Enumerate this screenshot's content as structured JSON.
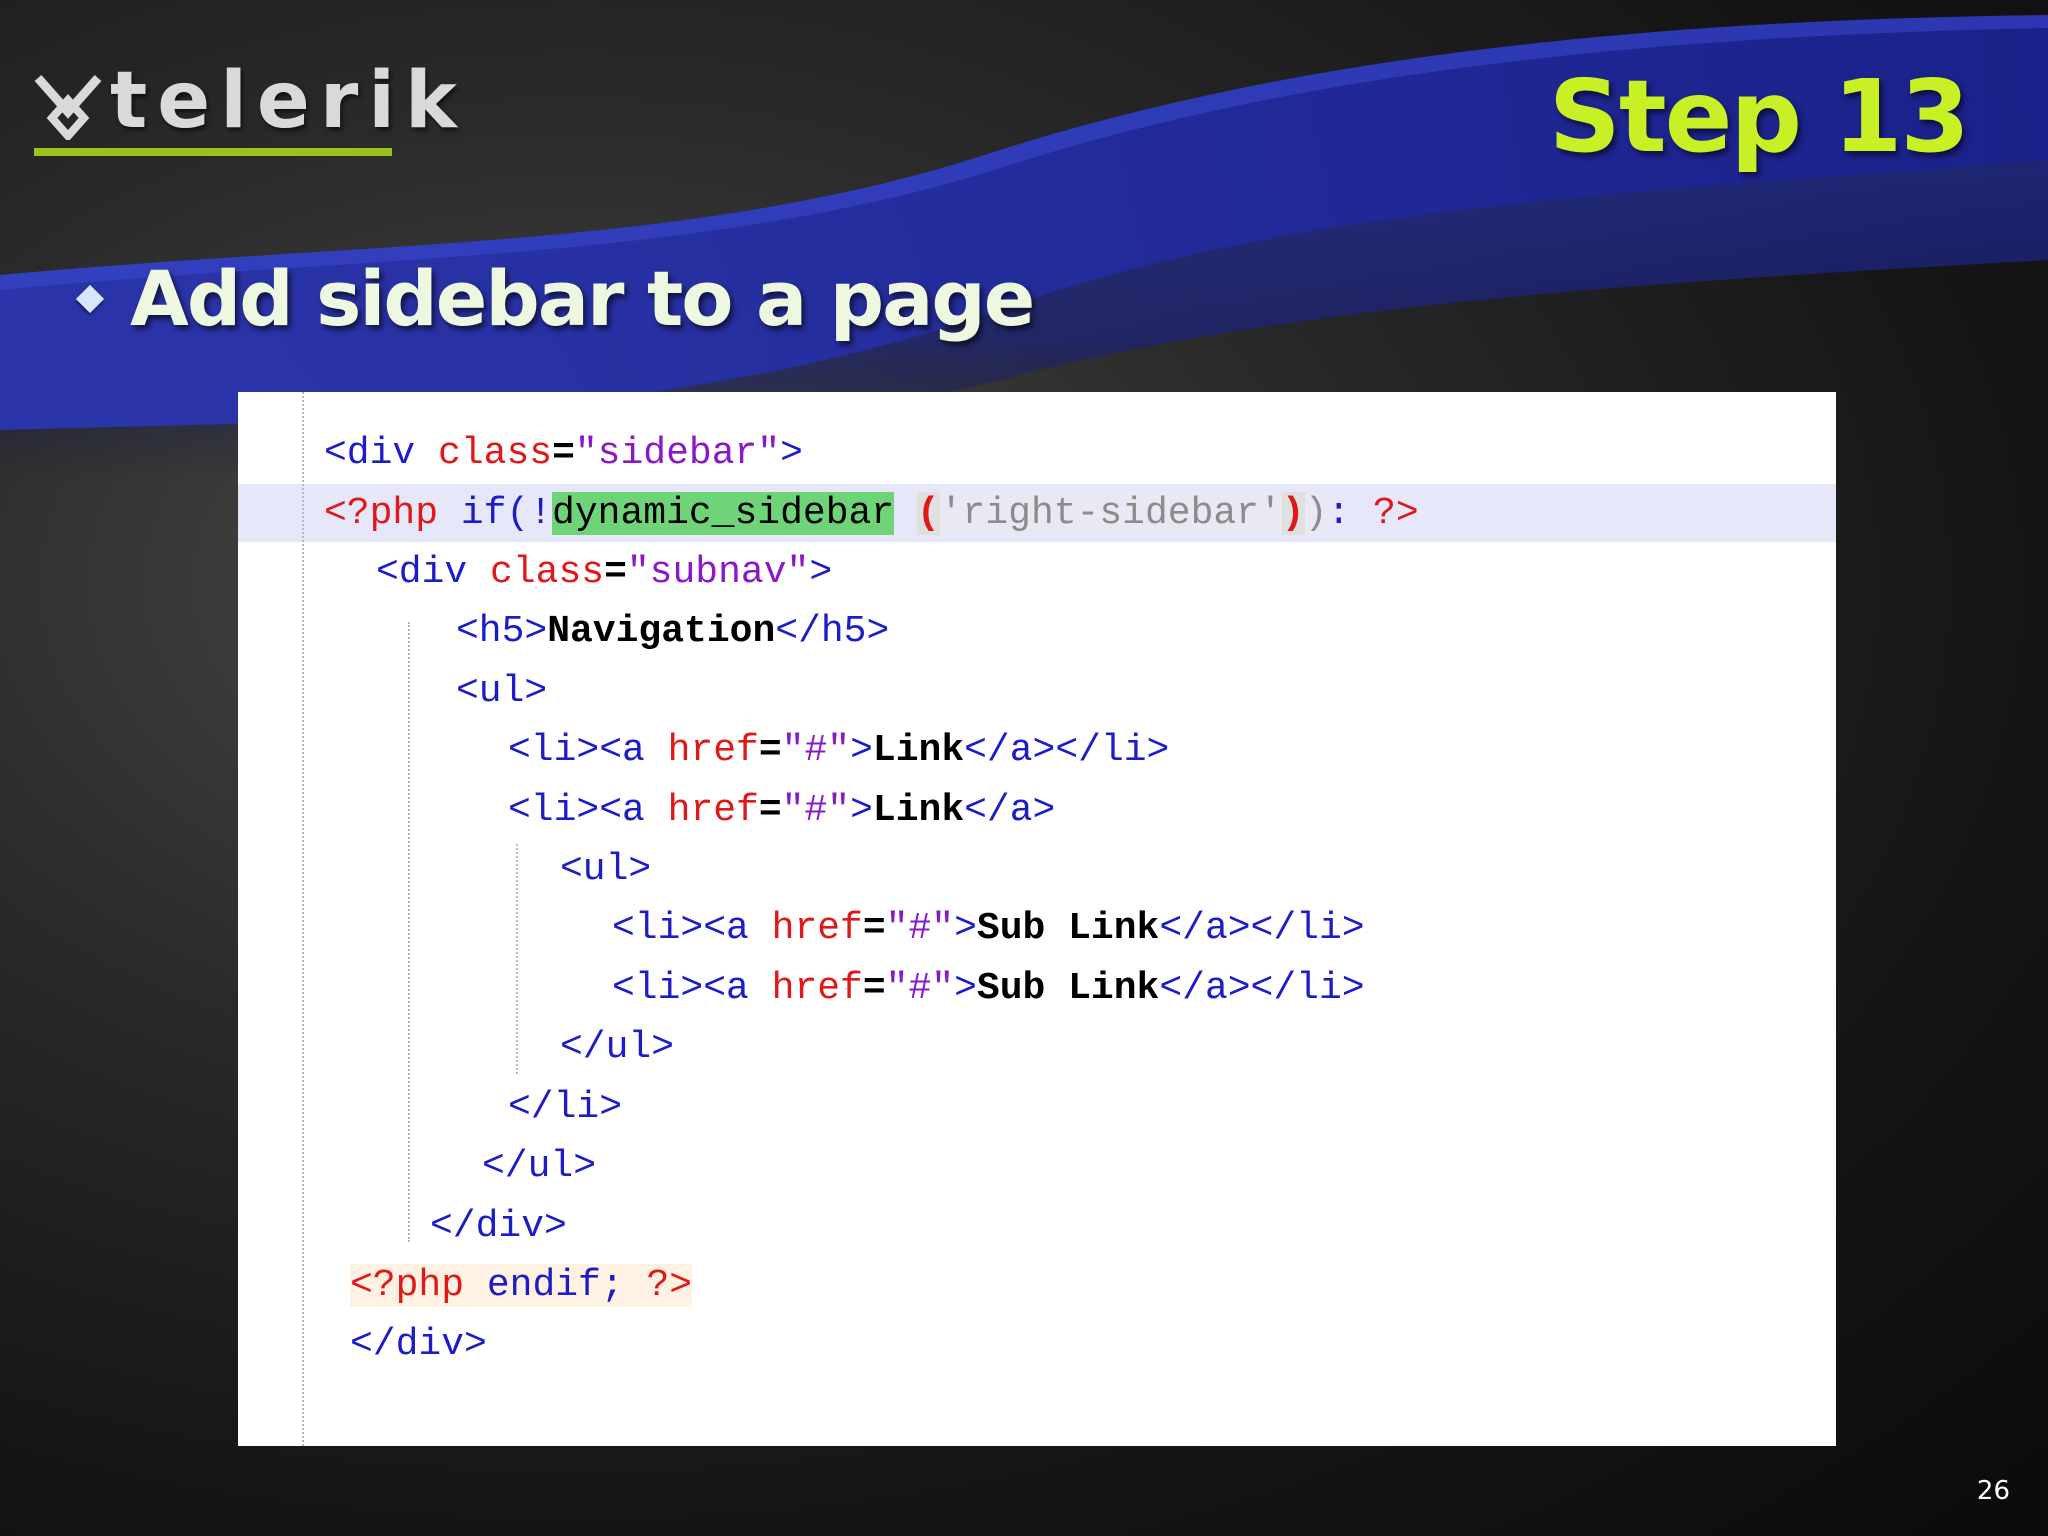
{
  "logo": {
    "text": "telerik",
    "icon": "telerik-logo-icon"
  },
  "slide": {
    "title": "Step 13",
    "bullet": "Add sidebar to a page",
    "page_number": "26"
  },
  "code": {
    "l1": {
      "a": "<div ",
      "b": "class",
      "c": "=",
      "d": "\"sidebar\"",
      "e": ">"
    },
    "l2": {
      "a": "<?php ",
      "b": "if(!",
      "c": "dynamic_sidebar",
      "d": "(",
      "e": "'right-sidebar'",
      "f": ")",
      "g": ")",
      "h": ": ",
      "i": "?>"
    },
    "l3": {
      "a": "<div ",
      "b": "class",
      "c": "=",
      "d": "\"subnav\"",
      "e": ">"
    },
    "l4": {
      "a": "<h5>",
      "b": "Navigation",
      "c": "</h5>"
    },
    "l5": {
      "a": "<ul>"
    },
    "l6": {
      "a": "<li><a ",
      "b": "href",
      "c": "=",
      "d": "\"#\"",
      "e": ">",
      "f": "Link",
      "g": "</a></li>"
    },
    "l7": {
      "a": "<li><a ",
      "b": "href",
      "c": "=",
      "d": "\"#\"",
      "e": ">",
      "f": "Link",
      "g": "</a>"
    },
    "l8": {
      "a": "<ul>"
    },
    "l9": {
      "a": "<li><a ",
      "b": "href",
      "c": "=",
      "d": "\"#\"",
      "e": ">",
      "f": "Sub Link",
      "g": "</a></li>"
    },
    "l10": {
      "a": "<li><a ",
      "b": "href",
      "c": "=",
      "d": "\"#\"",
      "e": ">",
      "f": "Sub Link",
      "g": "</a></li>"
    },
    "l11": {
      "a": "</ul>"
    },
    "l12": {
      "a": "</li>"
    },
    "l13": {
      "a": "</ul>"
    },
    "l14": {
      "a": "</div>"
    },
    "l15": {
      "a": "<?php",
      "b": " endif; ",
      "c": "?>"
    },
    "l16": {
      "a": "</div>"
    }
  },
  "colors": {
    "title": "#c8f024",
    "logo_bar": "#9bc11e",
    "wave_blue": "#1e2aa0"
  }
}
